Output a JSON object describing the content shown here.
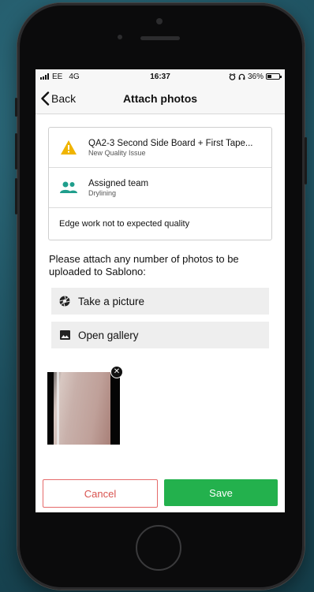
{
  "status_bar": {
    "carrier": "EE",
    "network": "4G",
    "time": "16:37",
    "battery_percent": "36%",
    "battery_level": 0.36
  },
  "nav": {
    "back_label": "Back",
    "title": "Attach photos"
  },
  "issue": {
    "title": "QA2-3 Second Side Board + First Tape...",
    "subtitle": "New Quality Issue",
    "icon": "warning-icon",
    "icon_color": "#f0b400"
  },
  "team": {
    "title": "Assigned team",
    "subtitle": "Drylining",
    "icon": "team-icon",
    "icon_color": "#1f9e8c"
  },
  "description": "Edge work not to expected quality",
  "prompt": "Please attach any number of photos to be uploaded to Sablono:",
  "actions": {
    "take_picture": "Take a picture",
    "open_gallery": "Open gallery"
  },
  "footer": {
    "cancel_label": "Cancel",
    "save_label": "Save"
  },
  "colors": {
    "save": "#23b14d",
    "cancel": "#d9534f"
  }
}
